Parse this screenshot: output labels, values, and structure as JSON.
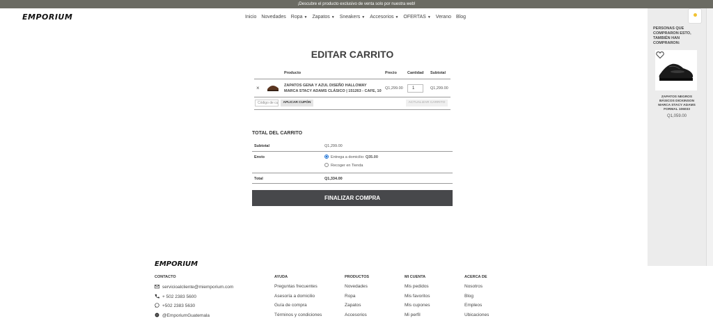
{
  "announcement": "¡Descubre el producto exclusivo de venta solo por nuestra web!",
  "brand": "EMPORIUM",
  "nav": {
    "items": [
      {
        "label": "Inicio",
        "dropdown": false
      },
      {
        "label": "Novedades",
        "dropdown": false
      },
      {
        "label": "Ropa",
        "dropdown": true
      },
      {
        "label": "Zapatos",
        "dropdown": true
      },
      {
        "label": "Sneakers",
        "dropdown": true
      },
      {
        "label": "Accesorios",
        "dropdown": true
      },
      {
        "label": "OFERTAS",
        "dropdown": true
      },
      {
        "label": "Verano",
        "dropdown": false
      },
      {
        "label": "Blog",
        "dropdown": false
      }
    ],
    "cart_count": "1"
  },
  "side_panel": {
    "heading": "PERSONAS QUE COMPRARON ESTO, TAMBIÉN HAN COMPRARON:",
    "product_name": "ZAPATOS NEGROS BÁSICOS DICKINSON MARCA STACY ADAMS FORMAL 106033",
    "product_price": "Q1,059.00"
  },
  "page_title": "EDITAR CARRITO",
  "cart": {
    "headers": {
      "product": "Producto",
      "price": "Precio",
      "quantity": "Cantidad",
      "subtotal": "Subtotal"
    },
    "items": [
      {
        "remove": "×",
        "name": "ZAPATOS GENA Y AZUL DISEÑO HALLOWAY MARCA STACY ADAMS CLÁSICO | 151263 - CAFE, 10",
        "price": "Q1,299.00",
        "quantity": "1",
        "subtotal": "Q1,299.00"
      }
    ],
    "coupon_placeholder": "Código de cupón",
    "apply_coupon": "APLICAR CUPÓN",
    "update_cart": "ACTUALIZAR CARRITO"
  },
  "totals": {
    "heading": "TOTAL DEL CARRITO",
    "subtotal_label": "Subtotal",
    "subtotal_value": "Q1,299.00",
    "shipping_label": "Envío",
    "shipping_option_1": "Entrega a domicilio:",
    "shipping_option_1_price": "Q35.00",
    "shipping_option_2": "Recoger en Tienda",
    "total_label": "Total",
    "total_value": "Q1,334.00"
  },
  "checkout_button": "FINALIZAR COMPRA",
  "footer": {
    "brand": "EMPORIUM",
    "contact": {
      "heading": "CONTACTO",
      "email": "servicioalcliente@miemporium.com",
      "phone": "+ 502 2383 5600",
      "whatsapp": "+502 2383 5630",
      "messenger": "@EmporiumGuatemala"
    },
    "ayuda": {
      "heading": "AYUDA",
      "items": [
        "Preguntas frecuentes",
        "Asesoría a domicilio",
        "Guía de compra",
        "Términos y condiciones"
      ]
    },
    "productos": {
      "heading": "PRODUCTOS",
      "items": [
        "Novedades",
        "Ropa",
        "Zapatos",
        "Accesorios"
      ]
    },
    "cuenta": {
      "heading": "MI CUENTA",
      "items": [
        "Mis pedidos",
        "Mis favoritos",
        "Mis cupones",
        "Mi perfil"
      ]
    },
    "acerca": {
      "heading": "ACERCA DE",
      "items": [
        "Nosotros",
        "Blog",
        "Empleos",
        "Ubicaciones"
      ]
    }
  },
  "colors": {
    "dark_button": "#47484b",
    "topbar": "#6b6b63",
    "radio_selected": "#1a6fd3"
  }
}
